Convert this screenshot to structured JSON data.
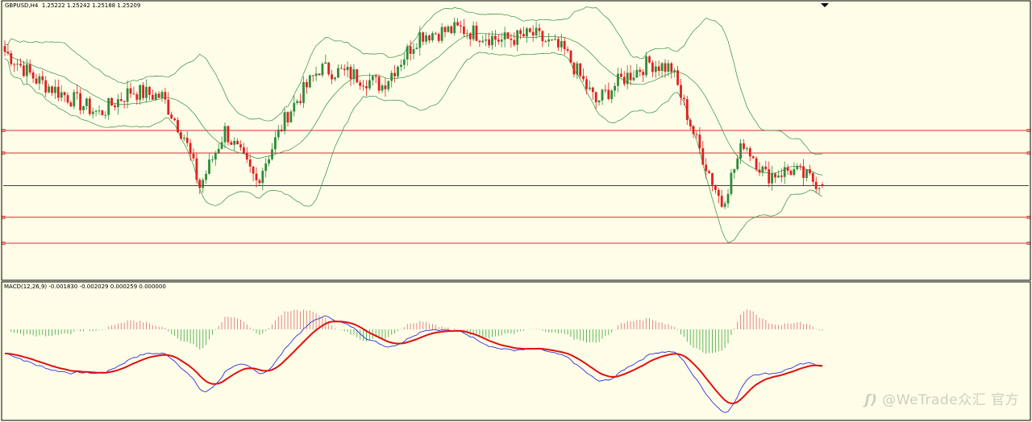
{
  "price_header": {
    "symbol": "GBPUSD,H4",
    "open": "1.25222",
    "high": "1.25242",
    "low": "1.25188",
    "close": "1.25209"
  },
  "macd_header": {
    "name": "MACD(12,26,9)",
    "main": "-0.001830",
    "signal": "-0.002029",
    "hist": "0.000259",
    "level": "0.000000"
  },
  "watermark": {
    "text": "@WeTrade众汇 官方"
  },
  "colors": {
    "background": "#fdfde8",
    "bull_candle": "#2e8b3a",
    "bear_candle": "#e02020",
    "bands": "#2f8f3f",
    "hline": "#d93030",
    "current_price_line": "#000000",
    "macd_main": "#3030e0",
    "macd_signal": "#e01010",
    "hist_pos": "#e07a7a",
    "hist_neg": "#4fae4f"
  },
  "chart_data": [
    {
      "type": "candlestick",
      "symbol": "GBPUSD",
      "timeframe": "H4",
      "y_range": [
        1.244,
        1.268
      ],
      "last_candle": {
        "open": 1.25222,
        "high": 1.25242,
        "low": 1.25188,
        "close": 1.25209
      },
      "trend_path": [
        {
          "i": 0,
          "p": 1.264
        },
        {
          "i": 10,
          "p": 1.2615
        },
        {
          "i": 20,
          "p": 1.26
        },
        {
          "i": 30,
          "p": 1.2585
        },
        {
          "i": 40,
          "p": 1.2605
        },
        {
          "i": 50,
          "p": 1.26
        },
        {
          "i": 57,
          "p": 1.2565
        },
        {
          "i": 62,
          "p": 1.252
        },
        {
          "i": 70,
          "p": 1.257
        },
        {
          "i": 80,
          "p": 1.2525
        },
        {
          "i": 90,
          "p": 1.2585
        },
        {
          "i": 100,
          "p": 1.2625
        },
        {
          "i": 110,
          "p": 1.262
        },
        {
          "i": 120,
          "p": 1.261
        },
        {
          "i": 132,
          "p": 1.2655
        },
        {
          "i": 145,
          "p": 1.266
        },
        {
          "i": 158,
          "p": 1.265
        },
        {
          "i": 168,
          "p": 1.2655
        },
        {
          "i": 178,
          "p": 1.264
        },
        {
          "i": 188,
          "p": 1.2595
        },
        {
          "i": 196,
          "p": 1.2615
        },
        {
          "i": 205,
          "p": 1.263
        },
        {
          "i": 212,
          "p": 1.2625
        },
        {
          "i": 220,
          "p": 1.256
        },
        {
          "i": 228,
          "p": 1.2505
        },
        {
          "i": 235,
          "p": 1.256
        },
        {
          "i": 242,
          "p": 1.253
        },
        {
          "i": 250,
          "p": 1.2535
        },
        {
          "i": 260,
          "p": 1.2522
        }
      ],
      "horizontal_levels": [
        1.257,
        1.255,
        1.2493,
        1.247
      ],
      "current_price_line": 1.2521
    },
    {
      "type": "macd",
      "params": [
        12,
        26,
        9
      ],
      "values": {
        "main": -0.00183,
        "signal": -0.002029,
        "histogram": 0.000259
      }
    }
  ]
}
